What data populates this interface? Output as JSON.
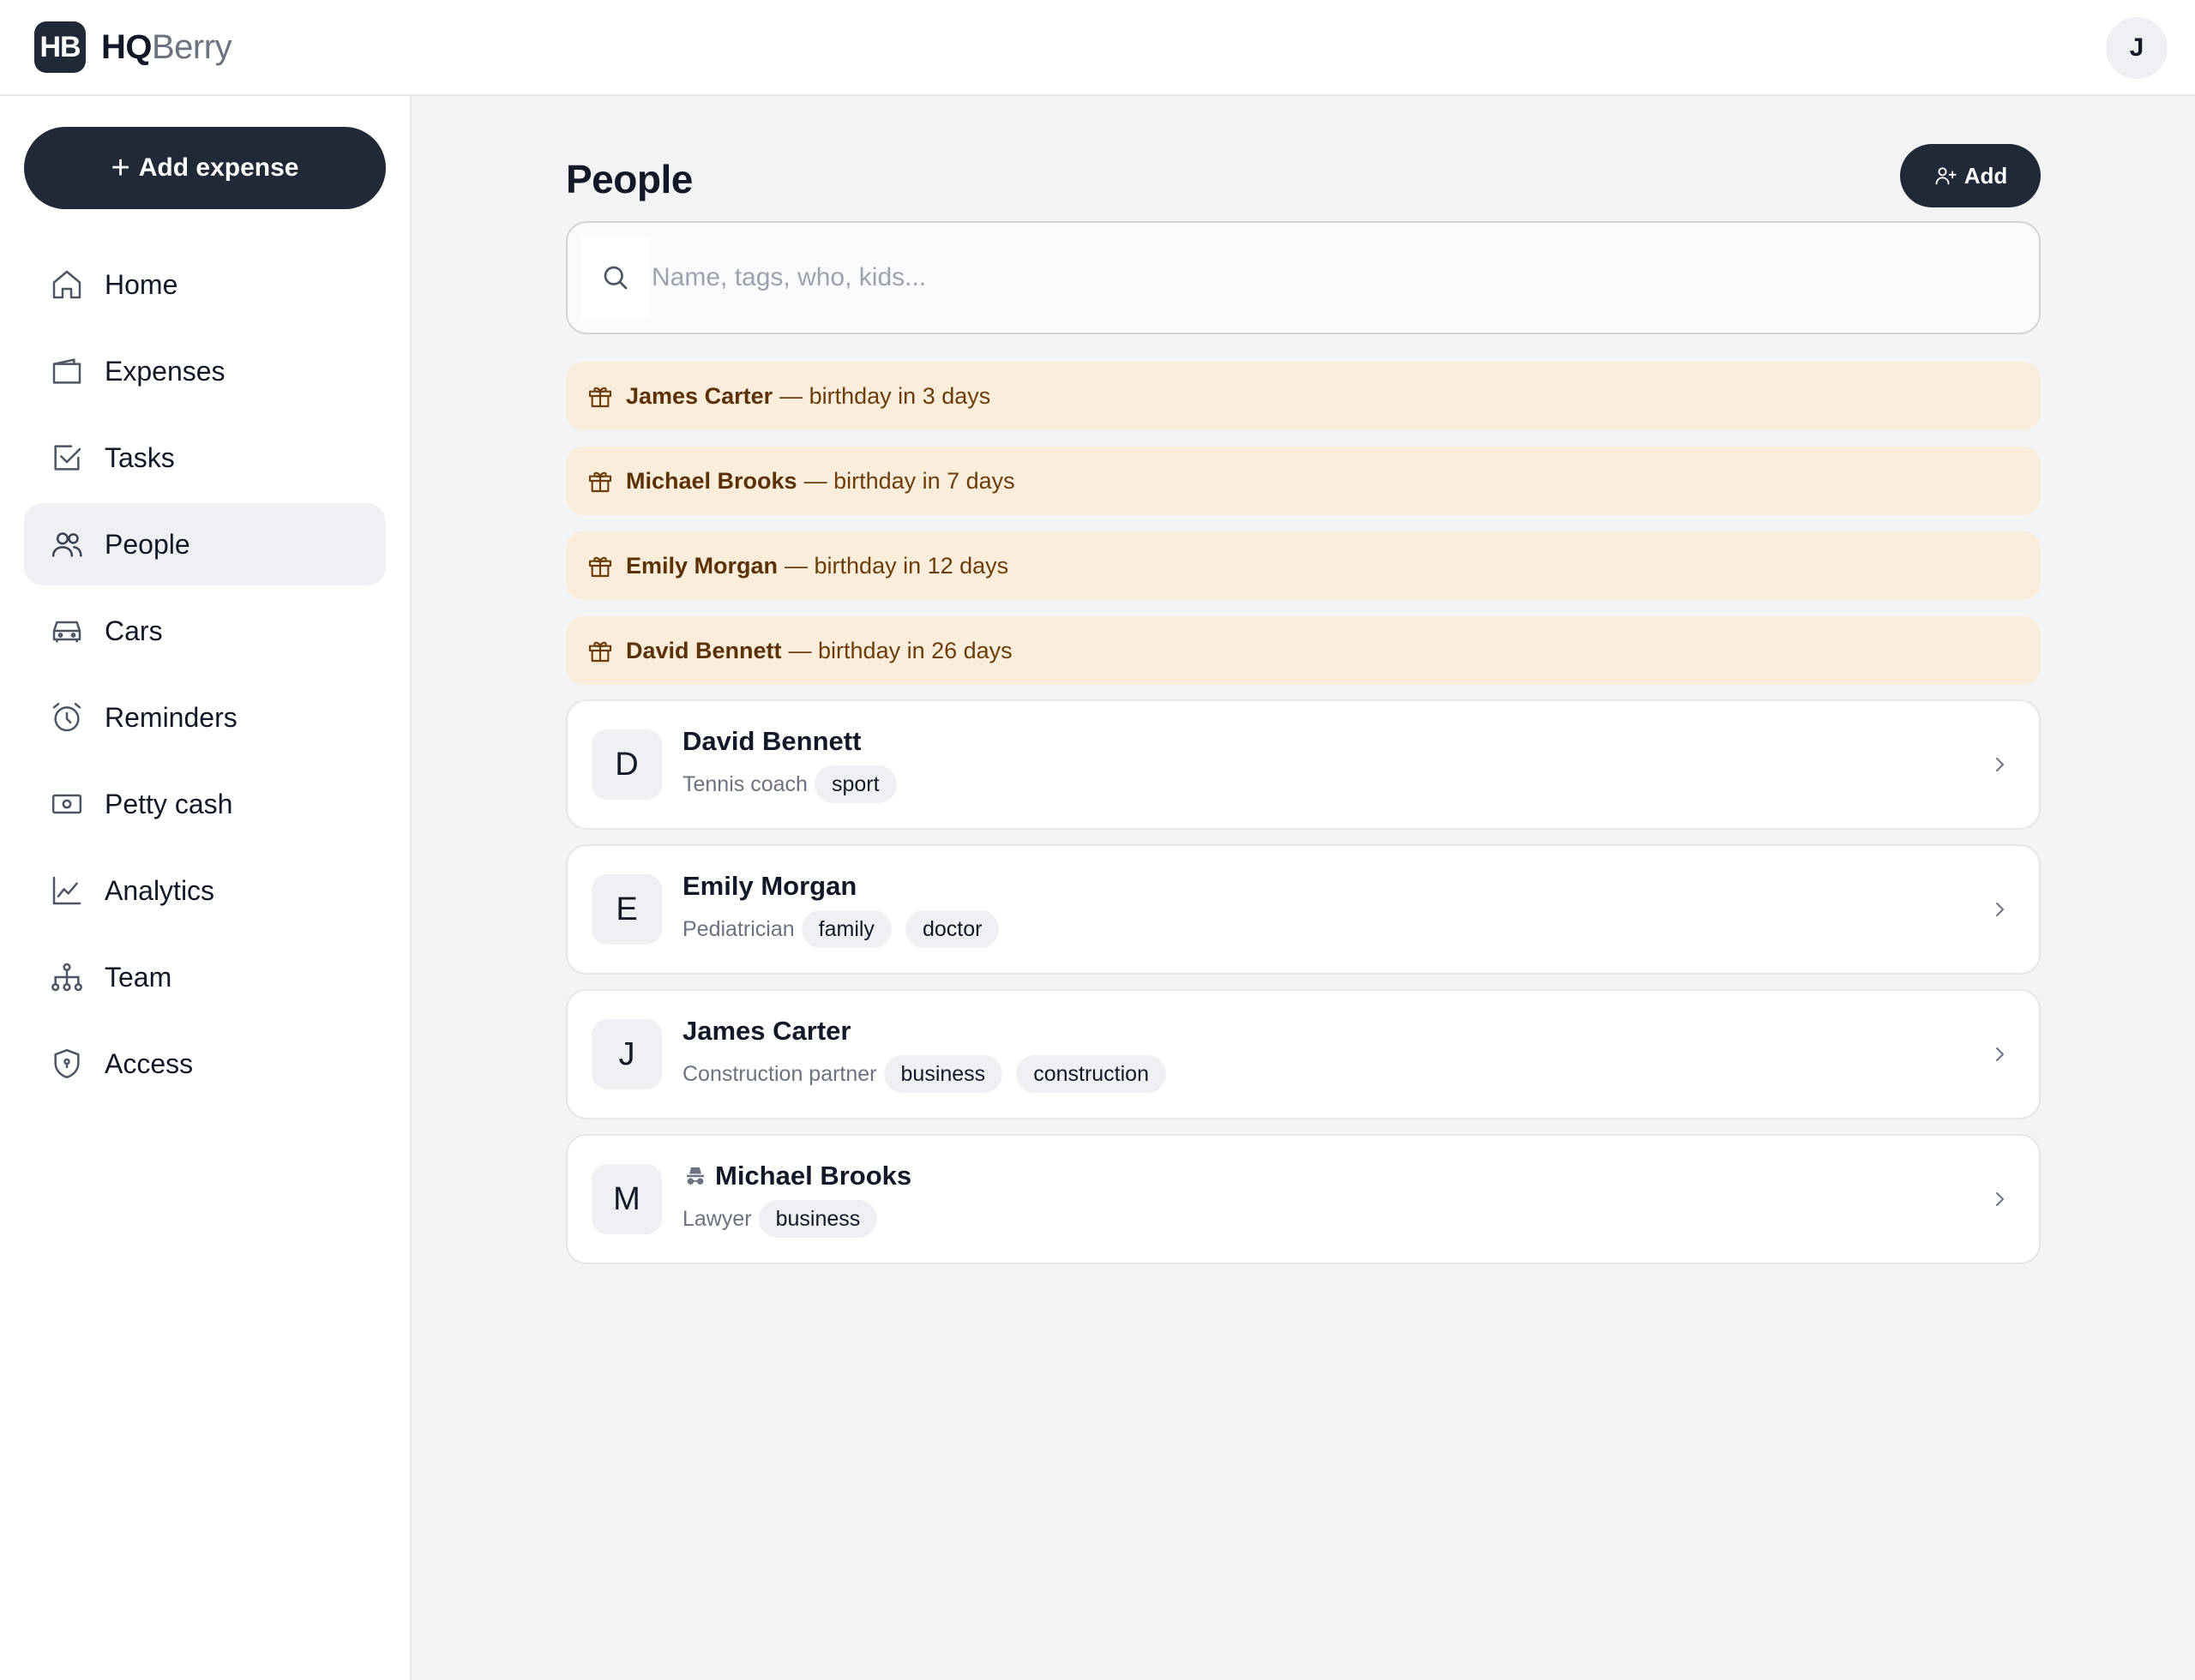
{
  "app": {
    "logo_mark": "HB",
    "brand_bold": "HQ",
    "brand_light": "Berry",
    "user_initial": "J"
  },
  "sidebar": {
    "add_expense_label": "Add expense",
    "items": [
      {
        "label": "Home",
        "icon": "home-icon"
      },
      {
        "label": "Expenses",
        "icon": "wallet-icon"
      },
      {
        "label": "Tasks",
        "icon": "checkbox-icon"
      },
      {
        "label": "People",
        "icon": "users-icon",
        "active": true
      },
      {
        "label": "Cars",
        "icon": "car-icon"
      },
      {
        "label": "Reminders",
        "icon": "alarm-clock-icon"
      },
      {
        "label": "Petty cash",
        "icon": "banknote-icon"
      },
      {
        "label": "Analytics",
        "icon": "line-chart-icon"
      },
      {
        "label": "Team",
        "icon": "org-chart-icon"
      },
      {
        "label": "Access",
        "icon": "shield-icon"
      }
    ]
  },
  "main": {
    "title": "People",
    "add_label": "Add",
    "search": {
      "placeholder": "Name, tags, who, kids...",
      "value": ""
    },
    "birthdays": [
      {
        "name": "James Carter",
        "text": "— birthday in 3 days"
      },
      {
        "name": "Michael Brooks",
        "text": "— birthday in 7 days"
      },
      {
        "name": "Emily Morgan",
        "text": "— birthday in 12 days"
      },
      {
        "name": "David Bennett",
        "text": "— birthday in 26 days"
      }
    ],
    "people": [
      {
        "initial": "D",
        "name": "David Bennett",
        "role": "Tennis coach",
        "tags": [
          "sport"
        ],
        "incognito": false
      },
      {
        "initial": "E",
        "name": "Emily Morgan",
        "role": "Pediatrician",
        "tags": [
          "family",
          "doctor"
        ],
        "incognito": false
      },
      {
        "initial": "J",
        "name": "James Carter",
        "role": "Construction partner",
        "tags": [
          "business",
          "construction"
        ],
        "incognito": false
      },
      {
        "initial": "M",
        "name": "Michael Brooks",
        "role": "Lawyer",
        "tags": [
          "business"
        ],
        "incognito": true
      }
    ]
  },
  "colors": {
    "primary": "#1f2937",
    "birthday_bg": "#fbeddb",
    "birthday_text": "#6b3d0a",
    "active_nav_bg": "#eef0f3"
  }
}
